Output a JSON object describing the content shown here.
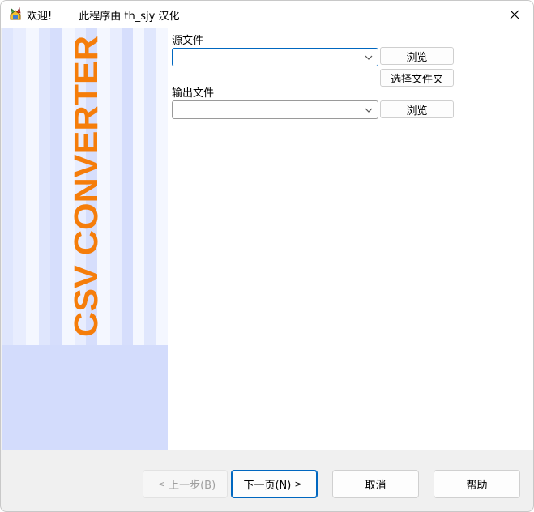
{
  "window": {
    "title": "欢迎!        此程序由 th_sjy 汉化"
  },
  "banner": {
    "text": "CSV CONVERTER"
  },
  "form": {
    "source_label": "源文件",
    "source_value": "",
    "browse_label": "浏览",
    "select_folder_label": "选择文件夹",
    "output_label": "输出文件",
    "output_value": "",
    "browse2_label": "浏览"
  },
  "footer": {
    "back_label": "上一步(B)",
    "next_label": "下一页(N)",
    "cancel_label": "取消",
    "help_label": "帮助"
  },
  "colors": {
    "banner_bg": "#d3dcfc",
    "banner_text": "#f57d0a",
    "accent": "#0067c0"
  }
}
